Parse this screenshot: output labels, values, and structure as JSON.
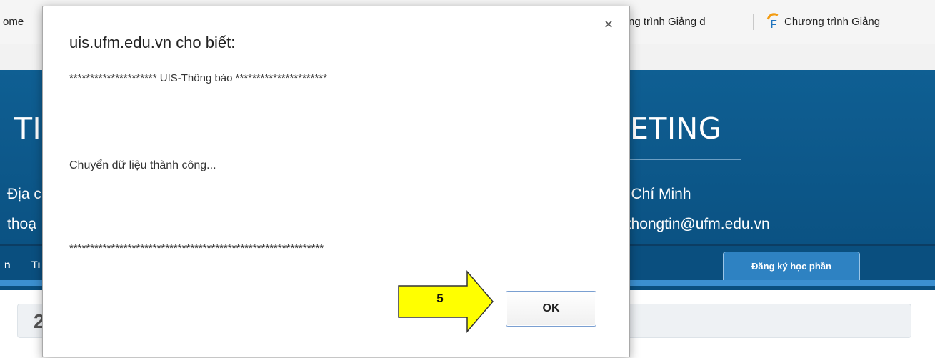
{
  "bookmarks": {
    "item_left": "ome",
    "item_mid": "ng trình Giảng d",
    "item_right": "Chương trình Giảng"
  },
  "site": {
    "title_left": "TI",
    "title_right": "ETING",
    "addr_line1_left": "Địa c",
    "addr_line1_right": "ồ Chí Minh",
    "addr_line2_left": "thoạ",
    "addr_line2_right": "nthongtin@ufm.edu.vn",
    "nav_left_1": "n",
    "nav_left_2": "Tı",
    "tab_register": "Đăng ký học phần",
    "panel_digit": "2"
  },
  "dialog": {
    "title": "uis.ufm.edu.vn cho biết:",
    "close_glyph": "×",
    "line1": "********************* UIS-Thông báo **********************",
    "line2": "Chuyển dữ liệu thành công...",
    "line3": "*************************************************************",
    "ok_label": "OK"
  },
  "annotation": {
    "step": "5",
    "arrow_fill": "#ffff00",
    "arrow_stroke": "#333333"
  },
  "colors": {
    "header_bg": "#0f5f93",
    "tab_bg": "#2e82c2",
    "ok_border": "#7a9fd1"
  }
}
